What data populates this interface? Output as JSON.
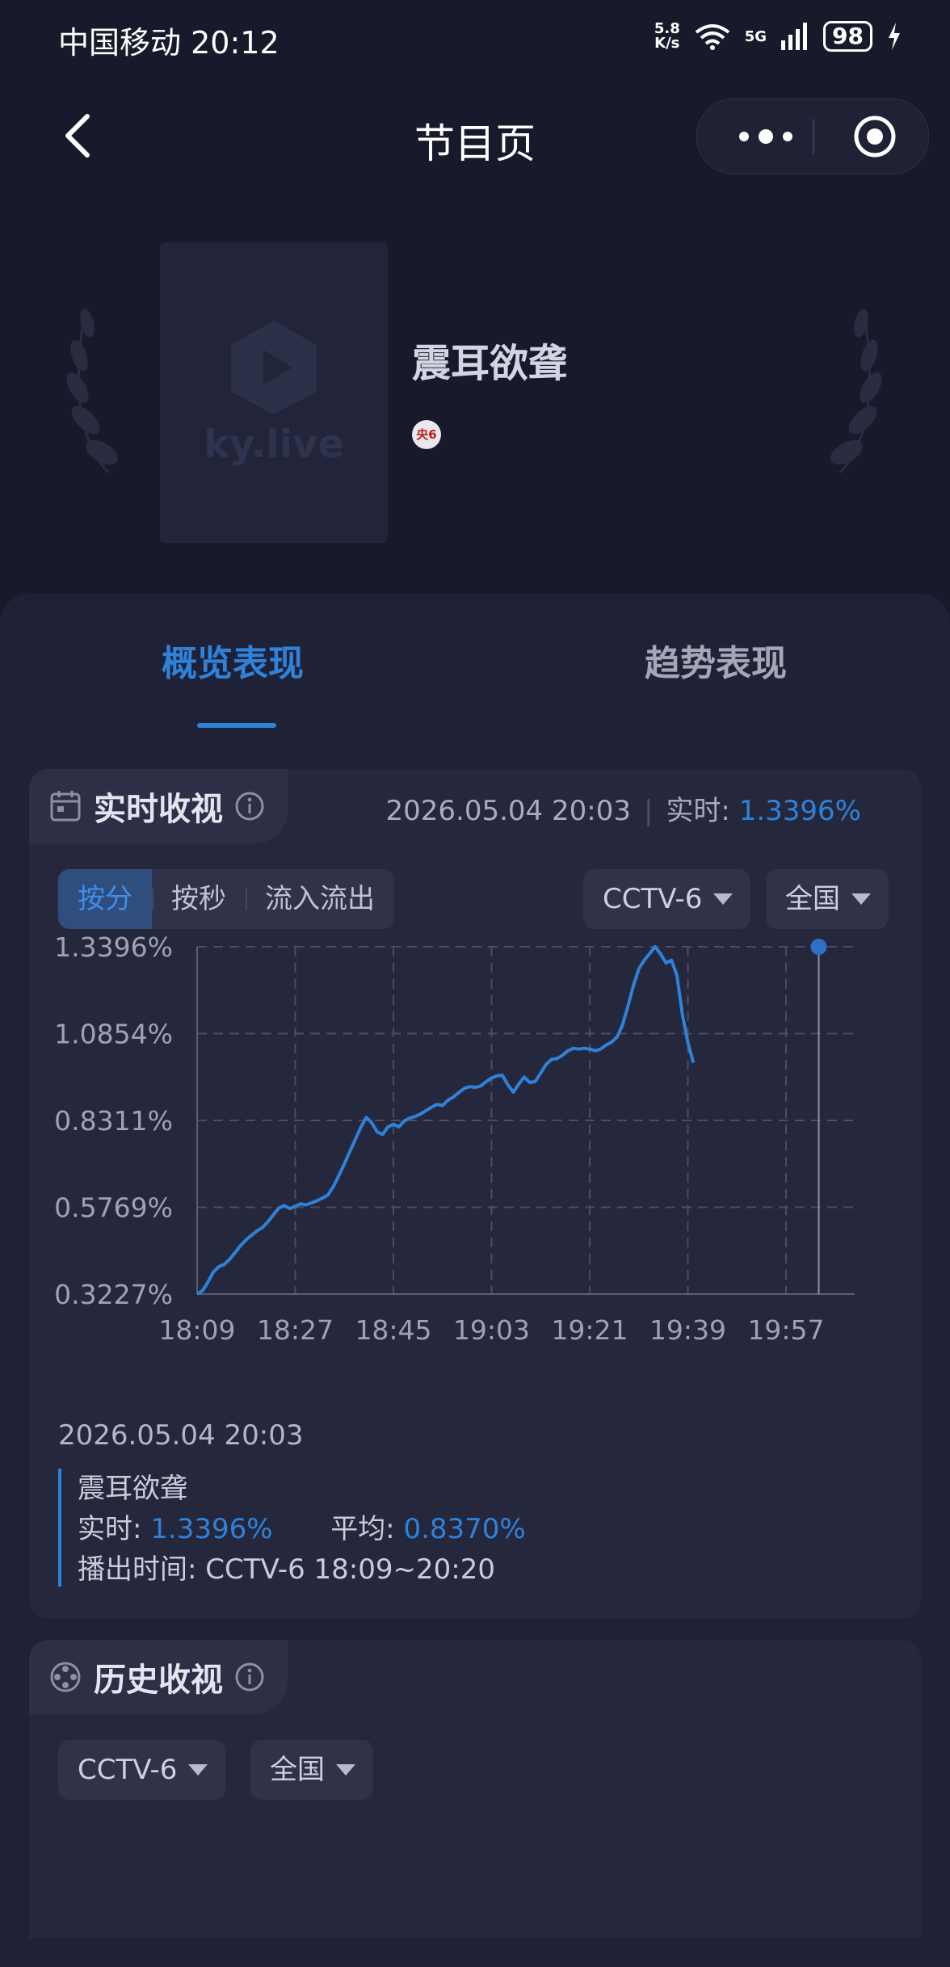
{
  "status_bar": {
    "carrier": "中国移动",
    "time": "20:12",
    "net_speed_value": "5.8",
    "net_speed_unit": "K/s",
    "network_type": "5G",
    "battery": "98"
  },
  "nav": {
    "title": "节目页"
  },
  "program": {
    "poster_logo_text": "ky.live",
    "title": "震耳欲聋",
    "channel_badge": "央6"
  },
  "tabs": [
    {
      "label": "概览表现",
      "active": true
    },
    {
      "label": "趋势表现",
      "active": false
    }
  ],
  "realtime": {
    "title": "实时收视",
    "timestamp": "2026.05.04 20:03",
    "realtime_label": "实时:",
    "realtime_value": "1.3396%",
    "modes": [
      "按分",
      "按秒",
      "流入流出"
    ],
    "active_mode": "按分",
    "channel": "CCTV-6",
    "region": "全国",
    "legend": {
      "timestamp": "2026.05.04 20:03",
      "program": "震耳欲聋",
      "realtime_label": "实时:",
      "realtime_value": "1.3396%",
      "average_label": "平均:",
      "average_value": "0.8370%",
      "airtime_label": "播出时间:",
      "airtime_value": "CCTV-6 18:09~20:20"
    }
  },
  "history": {
    "title": "历史收视",
    "channel": "CCTV-6",
    "region": "全国"
  },
  "colors": {
    "accent": "#2f82d9",
    "background": "#181a2c",
    "panel": "#1f2136",
    "card": "#25283d"
  },
  "chart_data": {
    "type": "line",
    "series": [
      {
        "values": [
          0.3227,
          0.333,
          0.358,
          0.388,
          0.403,
          0.41,
          0.425,
          0.445,
          0.465,
          0.482,
          0.495,
          0.508,
          0.518,
          0.535,
          0.555,
          0.575,
          0.582,
          0.573,
          0.58,
          0.587,
          0.584,
          0.59,
          0.596,
          0.604,
          0.613,
          0.638,
          0.67,
          0.704,
          0.74,
          0.775,
          0.81,
          0.84,
          0.825,
          0.798,
          0.79,
          0.812,
          0.82,
          0.812,
          0.83,
          0.838,
          0.843,
          0.85,
          0.86,
          0.87,
          0.878,
          0.875,
          0.89,
          0.9,
          0.913,
          0.925,
          0.93,
          0.928,
          0.932,
          0.945,
          0.955,
          0.962,
          0.963,
          0.935,
          0.914,
          0.938,
          0.958,
          0.942,
          0.945,
          0.97,
          0.995,
          1.01,
          1.012,
          1.022,
          1.035,
          1.042,
          1.04,
          1.042,
          1.04,
          1.035,
          1.04,
          1.052,
          1.06,
          1.075,
          1.11,
          1.165,
          1.225,
          1.275,
          1.3,
          1.32,
          1.3396,
          1.318,
          1.292,
          1.3,
          1.255,
          1.14,
          1.06,
          1.0
        ],
        "x_start": "18:09",
        "interval_minutes": 1
      }
    ],
    "x_ticks": [
      "18:09",
      "18:27",
      "18:45",
      "19:03",
      "19:21",
      "19:39",
      "19:57"
    ],
    "y_ticks": [
      "0.3227%",
      "0.5769%",
      "0.8311%",
      "1.0854%",
      "1.3396%"
    ],
    "ylim": [
      0.3227,
      1.3396
    ],
    "highlight_time": "20:03",
    "highlight_value": 1.3396,
    "grid": true
  }
}
